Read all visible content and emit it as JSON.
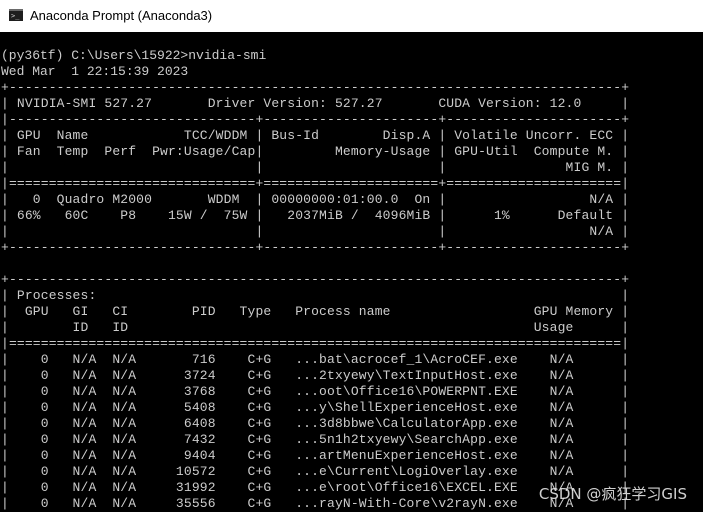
{
  "window": {
    "title": "Anaconda Prompt (Anaconda3)",
    "icon": "console-window-icon",
    "icon_glyph": ">_"
  },
  "console": {
    "prompt": "(py36tf) C:\\Users\\15922>nvidia-smi",
    "timestamp": "Wed Mar  1 22:15:39 2023",
    "smi_header": {
      "border_top": "+-----------------------------------------------------------------------------+",
      "version_line": "| NVIDIA-SMI 527.27       Driver Version: 527.27       CUDA Version: 12.0     |",
      "sep_dash": "|-------------------------------+----------------------+----------------------+",
      "col_header_1": "| GPU  Name            TCC/WDDM | Bus-Id        Disp.A | Volatile Uncorr. ECC |",
      "col_header_2": "| Fan  Temp  Perf  Pwr:Usage/Cap|         Memory-Usage | GPU-Util  Compute M. |",
      "col_header_3": "|                               |                      |               MIG M. |",
      "sep_double": "|===============================+======================+======================|",
      "gpu_row_1": "|   0  Quadro M2000       WDDM  | 00000000:01:00.0  On |                  N/A |",
      "gpu_row_2": "| 66%   60C    P8    15W /  75W |   2037MiB /  4096MiB |      1%      Default |",
      "gpu_row_3": "|                               |                      |                  N/A |",
      "border_bottom": "+-------------------------------+----------------------+----------------------+"
    },
    "processes": {
      "border_top": "+-----------------------------------------------------------------------------+",
      "title_line": "| Processes:                                                                  |",
      "header_1": "|  GPU   GI   CI        PID   Type   Process name                  GPU Memory |",
      "header_2": "|        ID   ID                                                   Usage      |",
      "sep_double": "|=============================================================================|",
      "rows": [
        "|    0   N/A  N/A       716    C+G   ...bat\\acrocef_1\\AcroCEF.exe    N/A      |",
        "|    0   N/A  N/A      3724    C+G   ...2txyewy\\TextInputHost.exe    N/A      |",
        "|    0   N/A  N/A      3768    C+G   ...oot\\Office16\\POWERPNT.EXE    N/A      |",
        "|    0   N/A  N/A      5408    C+G   ...y\\ShellExperienceHost.exe    N/A      |",
        "|    0   N/A  N/A      6408    C+G   ...3d8bbwe\\CalculatorApp.exe    N/A      |",
        "|    0   N/A  N/A      7432    C+G   ...5n1h2txyewy\\SearchApp.exe    N/A      |",
        "|    0   N/A  N/A      9404    C+G   ...artMenuExperienceHost.exe    N/A      |",
        "|    0   N/A  N/A     10572    C+G   ...e\\Current\\LogiOverlay.exe    N/A      |",
        "|    0   N/A  N/A     31992    C+G   ...e\\root\\Office16\\EXCEL.EXE    N/A      |",
        "|    0   N/A  N/A     35556    C+G   ...rayN-With-Core\\v2rayN.exe    N/A      |"
      ]
    }
  },
  "watermark": "CSDN @疯狂学习GIS"
}
